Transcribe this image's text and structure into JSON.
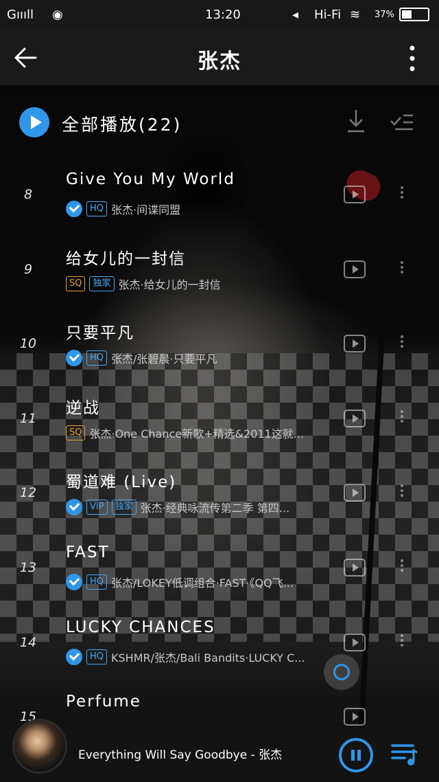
{
  "status_bar": {
    "signal": "Gıııll",
    "time": "13:20",
    "hifi": "Hi-Fi",
    "battery": "37%"
  },
  "header": {
    "title": "张杰"
  },
  "play_all": {
    "label": "全部播放(22)"
  },
  "songs": [
    {
      "num": "8",
      "title": "Give You My World",
      "badges": [
        "HQ"
      ],
      "meta": "张杰·间谍同盟",
      "checked": true
    },
    {
      "num": "9",
      "title": "给女儿的一封信",
      "badges": [
        "SQ",
        "独家"
      ],
      "meta": "张杰·给女儿的一封信",
      "checked": false
    },
    {
      "num": "10",
      "title": "只要平凡",
      "badges": [
        "HQ"
      ],
      "meta": "张杰/张碧晨·只要平凡",
      "checked": true
    },
    {
      "num": "11",
      "title": "逆战",
      "badges": [
        "SQ"
      ],
      "meta": "张杰·One Chance新歌+精选&2011这就...",
      "checked": false
    },
    {
      "num": "12",
      "title": "蜀道难 (Live)",
      "badges": [
        "VIP",
        "独家"
      ],
      "meta": "张杰·经典咏流传第二季 第四...",
      "checked": true
    },
    {
      "num": "13",
      "title": "FAST",
      "badges": [
        "HQ"
      ],
      "meta": "张杰/LOKEY低调组合·FAST·《QQ飞...",
      "checked": true
    },
    {
      "num": "14",
      "title": "LUCKY CHANCES",
      "badges": [
        "HQ"
      ],
      "meta": "KSHMR/张杰/Bali Bandits·LUCKY C...",
      "checked": true
    },
    {
      "num": "15",
      "title": "Perfume",
      "badges": [],
      "meta": "",
      "checked": false
    }
  ],
  "player": {
    "now_playing": "Everything Will Say Goodbye - 张杰"
  },
  "colors": {
    "accent": "#2f97ea",
    "sq": "#e8a134",
    "topbar": "#1a1a1a"
  }
}
